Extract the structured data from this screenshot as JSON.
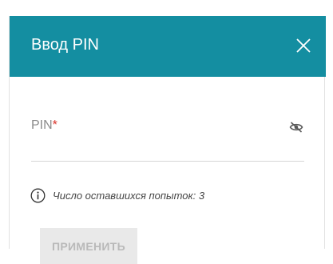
{
  "dialog": {
    "title": "Ввод PIN",
    "close_icon": "close-icon",
    "header_color": "#148ea1"
  },
  "pin_field": {
    "label": "PIN",
    "required_mark": "*",
    "value": "",
    "visibility_icon": "eye-slash-icon"
  },
  "attempts_note": {
    "icon": "info-icon",
    "text": "Число оставшихся попыток: 3"
  },
  "apply_button": {
    "label": "ПРИМЕНИТЬ",
    "state": "disabled"
  }
}
